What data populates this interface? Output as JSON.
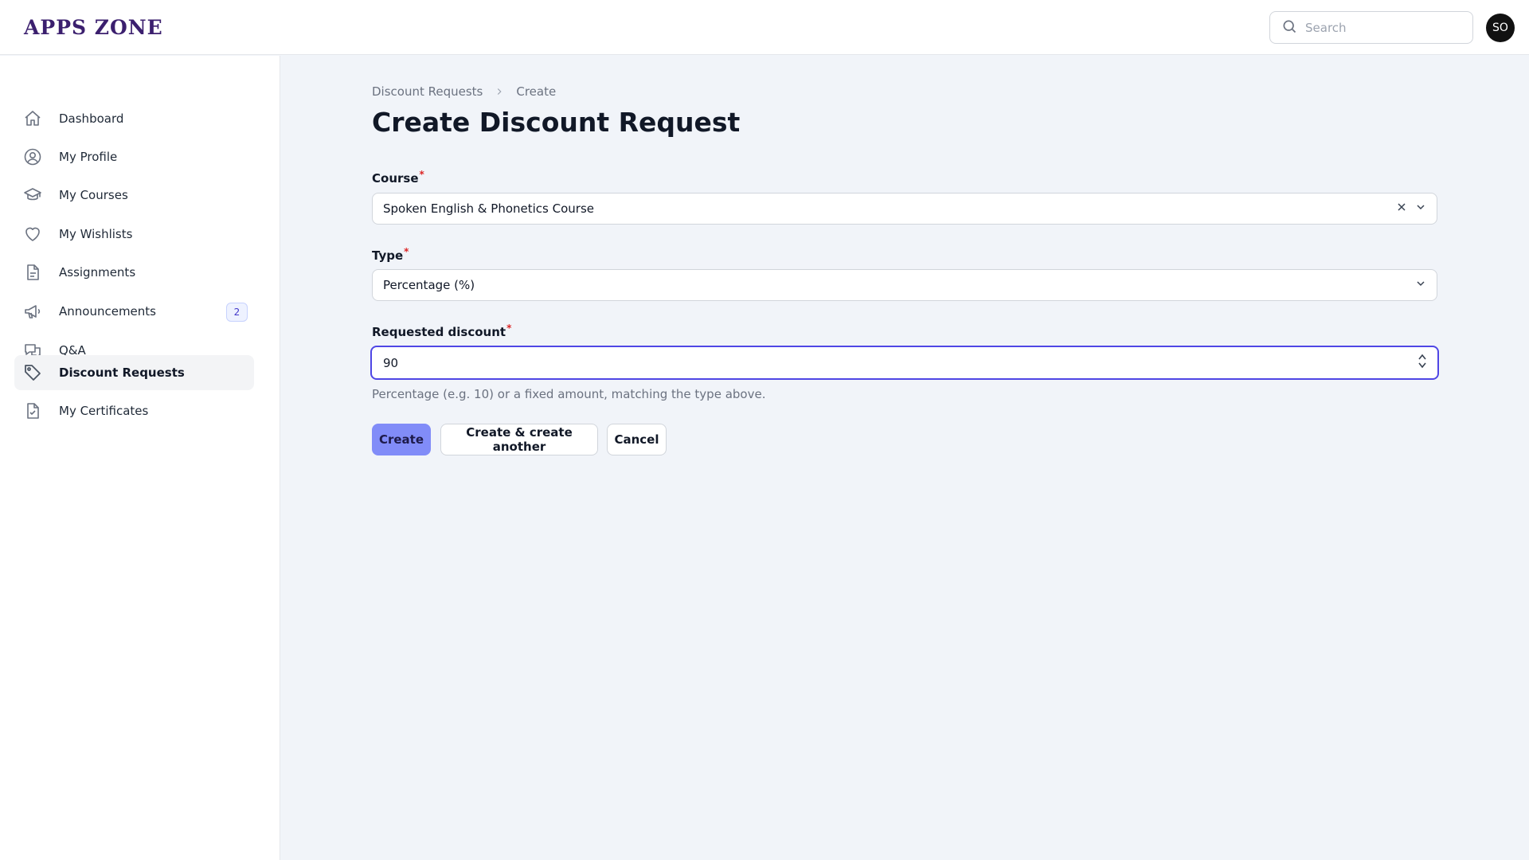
{
  "header": {
    "logo": "APPS ZONE",
    "search_placeholder": "Search",
    "avatar_initials": "SO"
  },
  "sidebar": {
    "items": [
      {
        "label": "Dashboard",
        "icon": "home-icon"
      },
      {
        "label": "My Profile",
        "icon": "user-circle-icon"
      },
      {
        "label": "My Courses",
        "icon": "graduation-cap-icon"
      },
      {
        "label": "My Wishlists",
        "icon": "heart-icon"
      },
      {
        "label": "Assignments",
        "icon": "document-icon"
      },
      {
        "label": "Announcements",
        "icon": "megaphone-icon",
        "badge": "2"
      },
      {
        "label": "Q&A",
        "icon": "chat-bubbles-icon"
      },
      {
        "label": "Discount Requests",
        "icon": "tag-icon",
        "active": true
      },
      {
        "label": "My Certificates",
        "icon": "document-check-icon"
      }
    ]
  },
  "breadcrumb": {
    "parent": "Discount Requests",
    "current": "Create"
  },
  "page_title": "Create Discount Request",
  "form": {
    "course": {
      "label": "Course",
      "required_mark": "*",
      "value": "Spoken English & Phonetics Course"
    },
    "type": {
      "label": "Type",
      "required_mark": "*",
      "value": "Percentage (%)"
    },
    "requested_discount": {
      "label": "Requested discount",
      "required_mark": "*",
      "value": "90",
      "helper": "Percentage (e.g. 10) or a fixed amount, matching the type above."
    }
  },
  "actions": {
    "create": "Create",
    "create_another": "Create & create another",
    "cancel": "Cancel"
  },
  "colors": {
    "primary": "#818cf8",
    "focus_ring": "#4f46e5",
    "required": "#dc2626",
    "logo": "#3b1f6e"
  }
}
